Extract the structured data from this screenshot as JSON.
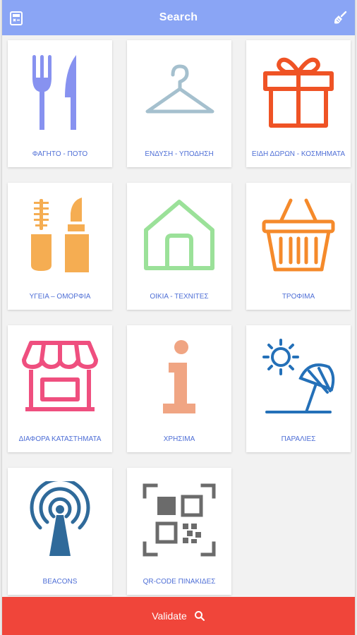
{
  "header": {
    "title": "Search",
    "left_icon": "calculator-icon",
    "right_icon": "broom-icon"
  },
  "categories": [
    {
      "label": "ΦΑΓΗΤΟ - ΠΟΤΟ",
      "icon": "fork-knife-icon",
      "color": "#8792f0"
    },
    {
      "label": "ΕΝΔΥΣΗ - ΥΠΟΔΗΣΗ",
      "icon": "hanger-icon",
      "color": "#a5c0ce"
    },
    {
      "label": "ΕΙΔΗ ΔΩΡΩΝ - ΚΟΣΜΗΜΑΤΑ",
      "icon": "gift-icon",
      "color": "#ef5325"
    },
    {
      "label": "ΥΓΕΙΑ – ΟΜΟΡΦΙΑ",
      "icon": "cosmetics-icon",
      "color": "#f5ad52"
    },
    {
      "label": "ΟΙΚΙΑ - ΤΕΧΝΙΤΕΣ",
      "icon": "house-icon",
      "color": "#9be199"
    },
    {
      "label": "ΤΡΟΦΙΜΑ",
      "icon": "basket-icon",
      "color": "#f58a2b"
    },
    {
      "label": "ΔΙΑΦΟΡΑ ΚΑΤΑΣΤΗΜΑΤΑ",
      "icon": "storefront-icon",
      "color": "#ef4f7f"
    },
    {
      "label": "ΧΡΗΣΙΜΑ",
      "icon": "info-icon",
      "color": "#f0a583"
    },
    {
      "label": "ΠΑΡΑΛΙΕΣ",
      "icon": "beach-icon",
      "color": "#2470b8"
    },
    {
      "label": "BEACONS",
      "icon": "beacon-icon",
      "color": "#2f6a9a"
    },
    {
      "label": "QR-CODE ΠΙΝΑΚΙΔΕΣ",
      "icon": "qr-code-icon",
      "color": "#6b6b6b"
    }
  ],
  "footer": {
    "button_label": "Validate",
    "button_icon": "search-icon"
  },
  "colors": {
    "header_bg": "#8aa5f5",
    "footer_bg": "#f0453a",
    "label_text": "#4f6fd6"
  }
}
